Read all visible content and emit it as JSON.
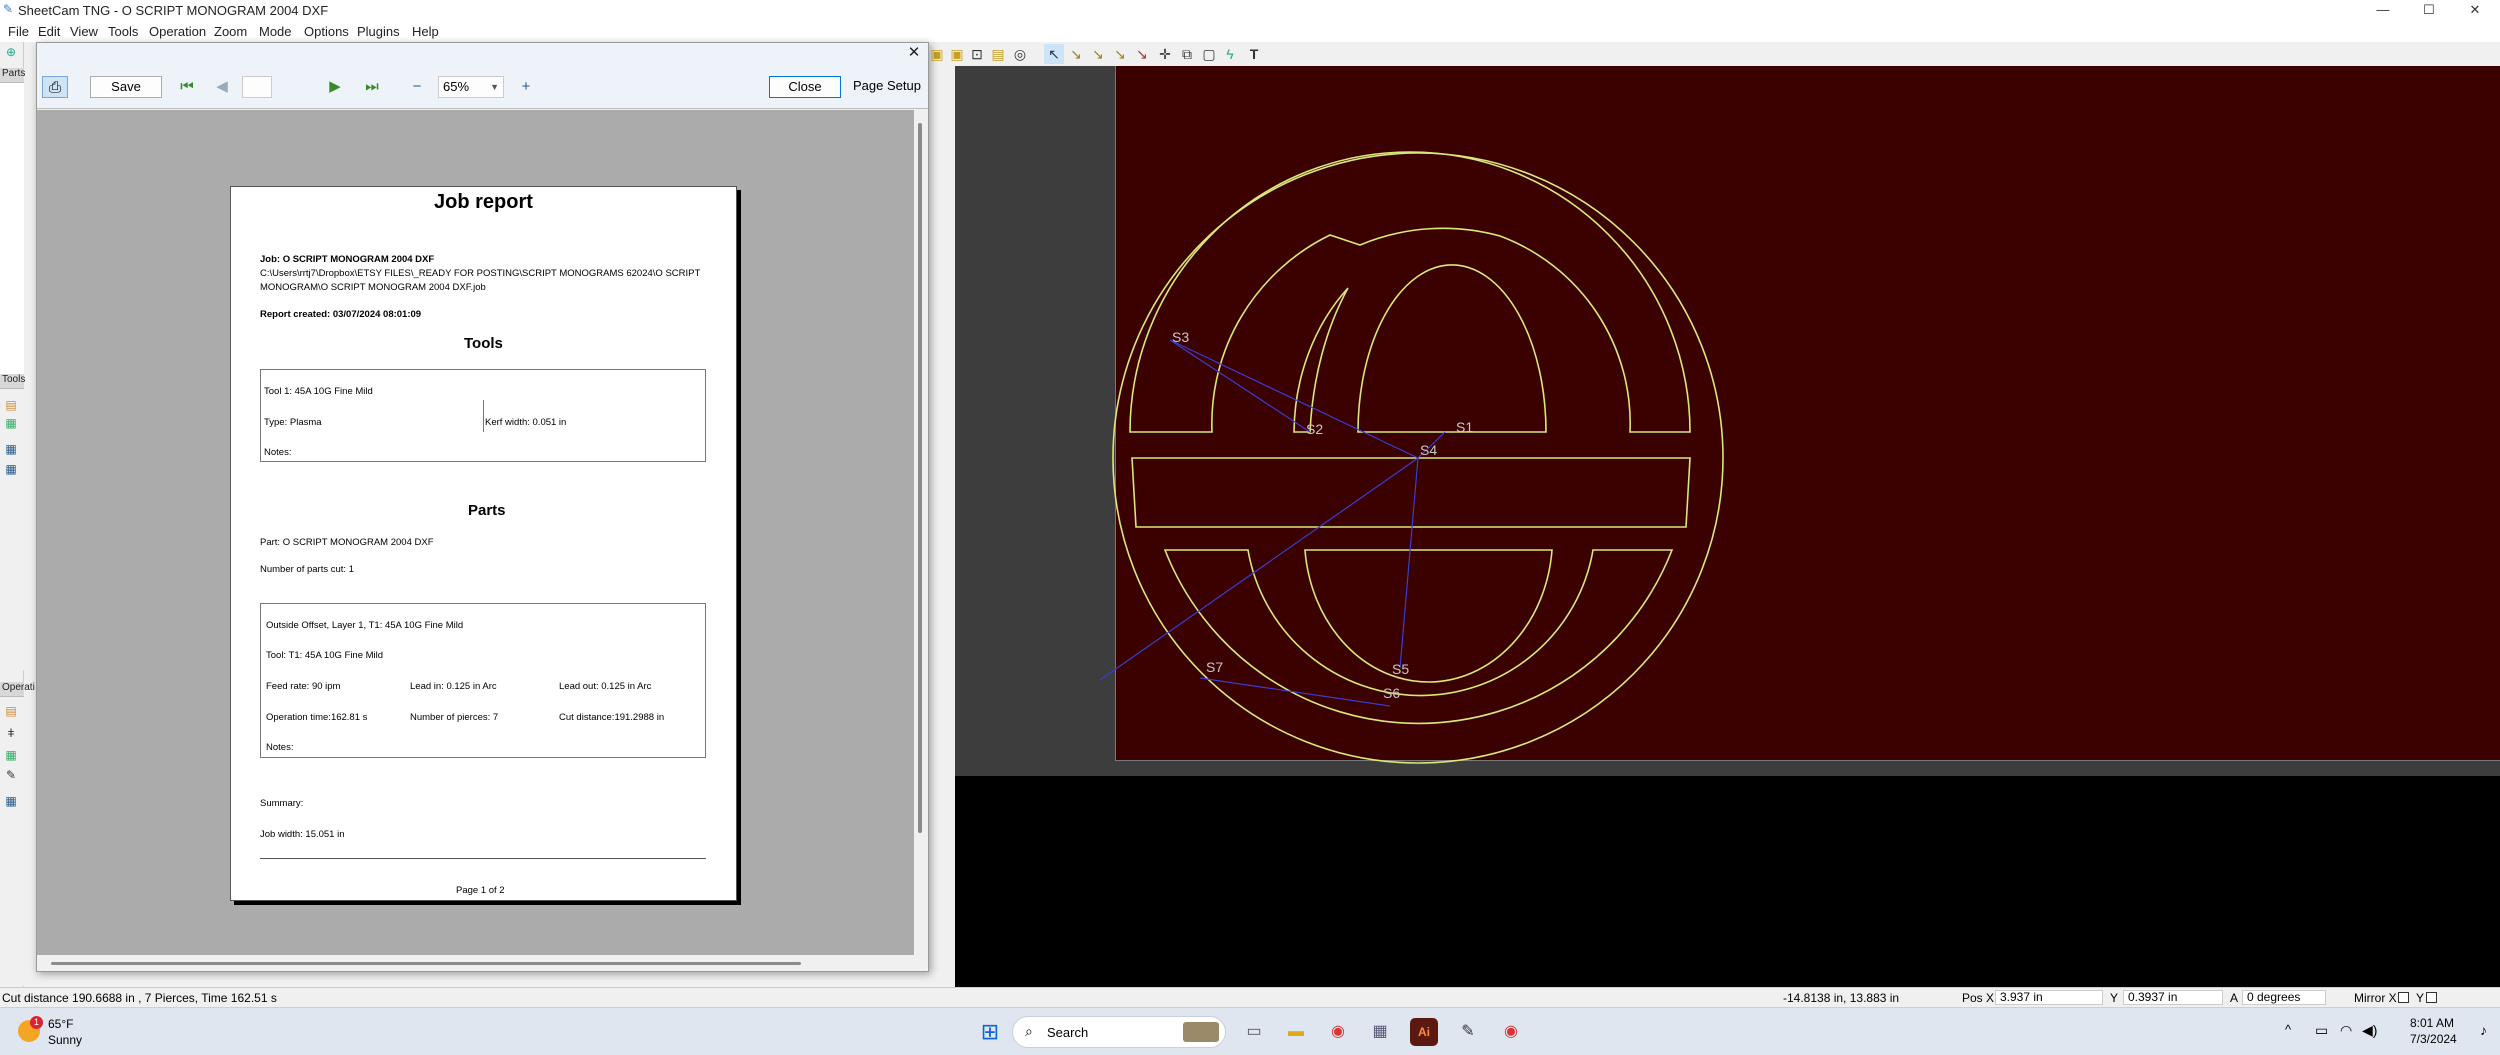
{
  "window": {
    "title": "SheetCam TNG - O SCRIPT MONOGRAM 2004 DXF",
    "minimize": "—",
    "maximize": "☐",
    "close": "✕"
  },
  "menu": [
    "File",
    "Edit",
    "View",
    "Tools",
    "Operation",
    "Zoom",
    "Mode",
    "Options",
    "Plugins",
    "Help"
  ],
  "dock": {
    "parts": "Parts",
    "tools": "Tools",
    "operations": "Operati"
  },
  "preview": {
    "close_x": "✕",
    "save": "Save",
    "zoom": "65%",
    "close": "Close",
    "page_setup": "Page Setup",
    "page_field": ""
  },
  "report": {
    "title": "Job report",
    "job": "Job: O SCRIPT MONOGRAM 2004 DXF",
    "path1": "C:\\Users\\rrtj7\\Dropbox\\ETSY FILES\\_READY FOR POSTING\\SCRIPT MONOGRAMS 62024\\O SCRIPT",
    "path2": "MONOGRAM\\O SCRIPT MONOGRAM 2004 DXF.job",
    "created": "Report created: 03/07/2024 08:01:09",
    "tools_heading": "Tools",
    "tool1": "Tool 1: 45A 10G Fine Mild",
    "type": "Type: Plasma",
    "kerf": "Kerf width: 0.051 in",
    "tool_notes": "Notes:",
    "parts_heading": "Parts",
    "part": "Part: O SCRIPT MONOGRAM 2004 DXF",
    "parts_cut": "Number of parts cut: 1",
    "op_title": "Outside Offset, Layer 1, T1: 45A 10G Fine Mild",
    "op_tool": "Tool: T1: 45A 10G Fine Mild",
    "feed": "Feed rate: 90 ipm",
    "lead_in": "Lead in: 0.125 in Arc",
    "lead_out": "Lead out: 0.125 in Arc",
    "op_time": "Operation time:162.81 s",
    "pierces": "Number of pierces: 7",
    "cut_dist": "Cut distance:191.2988 in",
    "op_notes": "Notes:",
    "summary": "Summary:",
    "job_width": "Job width: 15.051 in",
    "page": "Page 1 of 2"
  },
  "canvas": {
    "labels": [
      "S3",
      "S2",
      "S1",
      "S4",
      "S7",
      "S5",
      "S6"
    ]
  },
  "status": {
    "left": "Cut distance 190.6688 in , 7 Pierces, Time 162.51 s",
    "coords": "-14.8138 in, 13.883 in",
    "posx_label": "Pos X",
    "posx": "3.937 in",
    "y_label": "Y",
    "y": "0.3937 in",
    "a_label": "A",
    "a": "0 degrees",
    "mirror_x": "Mirror X",
    "mirror_y": "Y"
  },
  "taskbar": {
    "temp": "65°F",
    "weather": "Sunny",
    "badge": "1",
    "search": "Search",
    "time": "8:01 AM",
    "date": "7/3/2024"
  },
  "colors": {
    "canvas": "#3b0000",
    "path": "#d8e87a",
    "rapid": "#3b3bd6"
  }
}
